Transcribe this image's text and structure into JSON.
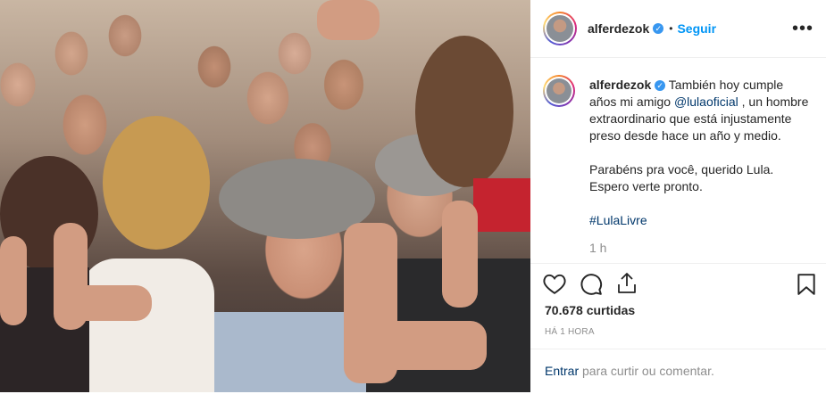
{
  "header": {
    "username": "alferdezok",
    "separator": "•",
    "follow_label": "Seguir",
    "more_icon": "more-horizontal-icon"
  },
  "caption": {
    "username": "alferdezok",
    "line1_a": "También hoy cumple",
    "line2_a": "años mi amigo ",
    "mention": "@lulaoficial",
    "line2_b": " , un hombre",
    "line3": "extraordinario que está injustamente",
    "line4": "preso desde hace un año y medio.",
    "line5": "Parabéns pra você, querido Lula.",
    "line6": "Espero verte pronto.",
    "hashtag": "#LulaLivre",
    "age": "1 h"
  },
  "actions": {
    "like_icon": "heart-icon",
    "comment_icon": "comment-icon",
    "share_icon": "share-icon",
    "save_icon": "bookmark-icon",
    "likes_count": "70.678 curtidas",
    "posted": "HÁ 1 HORA",
    "login_link": "Entrar",
    "login_rest": " para curtir ou comentar."
  },
  "colors": {
    "accent": "#0095f6",
    "link": "#00376b",
    "muted": "#8e8e8e",
    "verified": "#3897f0"
  }
}
